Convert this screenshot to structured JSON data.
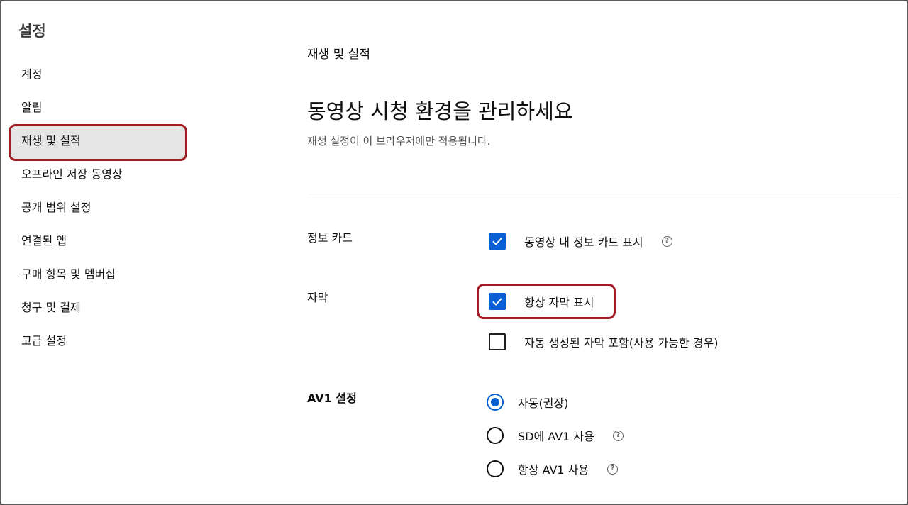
{
  "sidebar": {
    "title": "설정",
    "items": [
      {
        "label": "계정"
      },
      {
        "label": "알림"
      },
      {
        "label": "재생 및 실적"
      },
      {
        "label": "오프라인 저장 동영상"
      },
      {
        "label": "공개 범위 설정"
      },
      {
        "label": "연결된 앱"
      },
      {
        "label": "구매 항목 및 멤버십"
      },
      {
        "label": "청구 및 결제"
      },
      {
        "label": "고급 설정"
      }
    ],
    "active_index": 2
  },
  "main": {
    "section_label": "재생 및 실적",
    "headline": "동영상 시청 환경을 관리하세요",
    "subtitle": "재생 설정이 이 브라우저에만 적용됩니다.",
    "info_cards": {
      "label": "정보 카드",
      "option": {
        "label": "동영상 내 정보 카드 표시",
        "checked": true
      }
    },
    "captions": {
      "label": "자막",
      "options": [
        {
          "label": "항상 자막 표시",
          "checked": true
        },
        {
          "label": "자동 생성된 자막 포함(사용 가능한 경우)",
          "checked": false
        }
      ]
    },
    "av1": {
      "label": "AV1 설정",
      "options": [
        {
          "label": "자동(권장)",
          "selected": true
        },
        {
          "label": "SD에 AV1 사용",
          "selected": false
        },
        {
          "label": "항상 AV1 사용",
          "selected": false
        }
      ]
    }
  },
  "icons": {
    "help": "?",
    "check": "check-icon"
  },
  "colors": {
    "accent": "#065fd4",
    "highlight": "#a01e23",
    "active_bg": "#e5e5e5"
  }
}
